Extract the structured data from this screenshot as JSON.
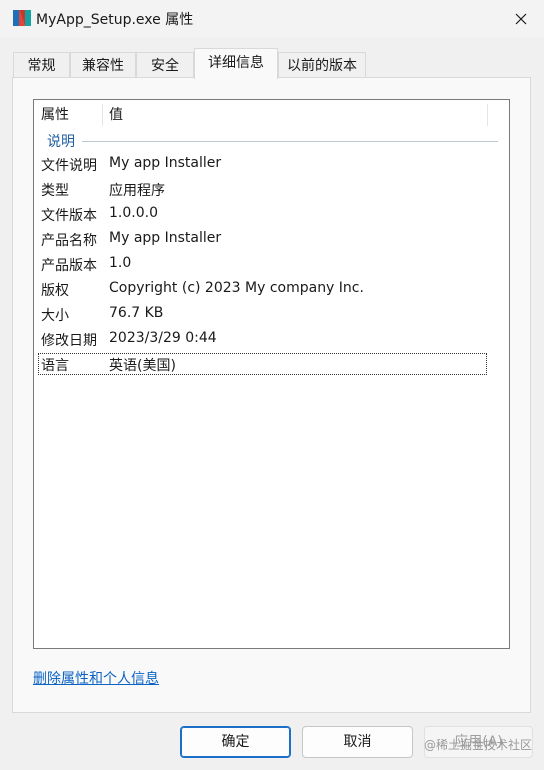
{
  "window": {
    "title": "MyApp_Setup.exe 属性"
  },
  "tabs": [
    {
      "label": "常规"
    },
    {
      "label": "兼容性"
    },
    {
      "label": "安全"
    },
    {
      "label": "详细信息",
      "active": true
    },
    {
      "label": "以前的版本"
    }
  ],
  "details": {
    "columns": {
      "property": "属性",
      "value": "值"
    },
    "group": "说明",
    "rows": [
      {
        "key": "文件说明",
        "value": "My app Installer"
      },
      {
        "key": "类型",
        "value": "应用程序"
      },
      {
        "key": "文件版本",
        "value": "1.0.0.0"
      },
      {
        "key": "产品名称",
        "value": "My app Installer"
      },
      {
        "key": "产品版本",
        "value": "1.0"
      },
      {
        "key": "版权",
        "value": "Copyright (c) 2023 My company Inc."
      },
      {
        "key": "大小",
        "value": "76.7 KB"
      },
      {
        "key": "修改日期",
        "value": "2023/3/29 0:44"
      },
      {
        "key": "语言",
        "value": "英语(美国)"
      }
    ]
  },
  "link": {
    "label": "删除属性和个人信息"
  },
  "buttons": {
    "ok": "确定",
    "cancel": "取消",
    "apply": "应用(A)"
  },
  "watermark": "@稀土掘金技术社区"
}
